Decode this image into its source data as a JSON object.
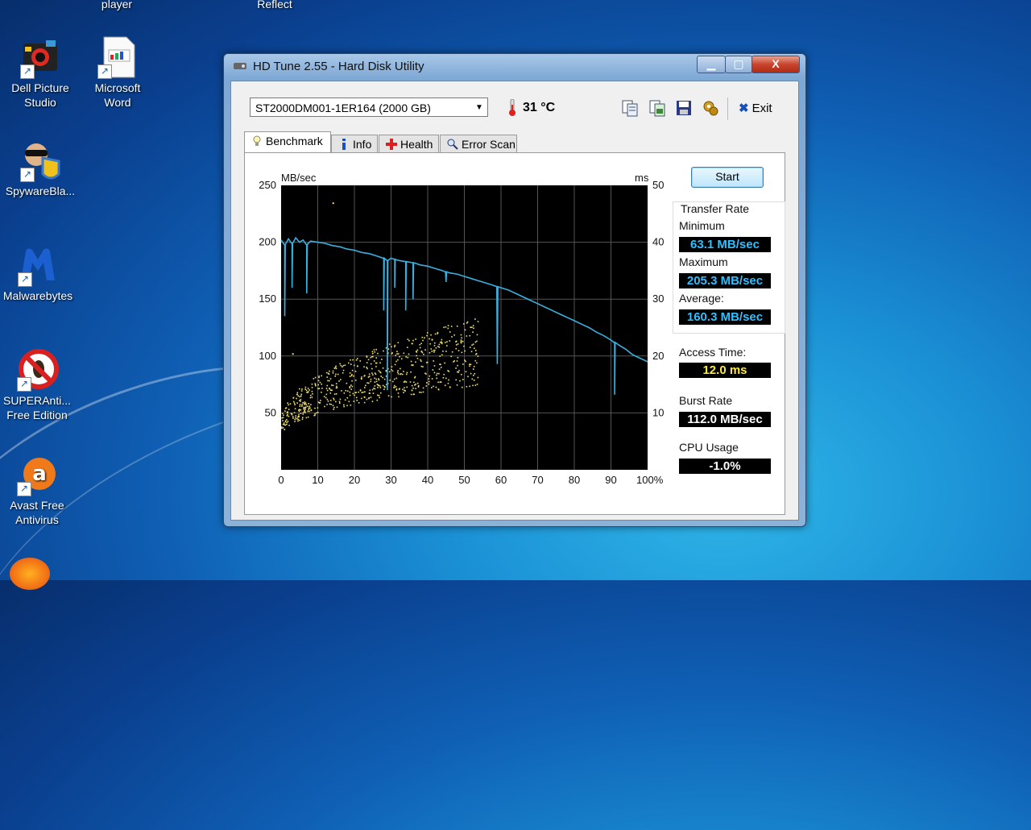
{
  "desktop": {
    "top_labels": [
      "player",
      "Reflect"
    ],
    "icons": [
      {
        "label1": "Dell Picture",
        "label2": "Studio"
      },
      {
        "label1": "Microsoft",
        "label2": "Word"
      },
      {
        "label1": "SpywareBla...",
        "label2": ""
      },
      {
        "label1": "Malwarebytes",
        "label2": ""
      },
      {
        "label1": "SUPERAnti...",
        "label2": "Free Edition"
      },
      {
        "label1": "Avast Free",
        "label2": "Antivirus"
      }
    ]
  },
  "window": {
    "title": "HD Tune 2.55 - Hard Disk Utility",
    "controls": {
      "minimize": "▁",
      "maximize": "▢",
      "close": "X"
    }
  },
  "toolbar": {
    "drive": "ST2000DM001-1ER164 (2000 GB)",
    "temperature": "31 °C",
    "exit_label": "Exit"
  },
  "tabs": [
    "Benchmark",
    "Info",
    "Health",
    "Error Scan"
  ],
  "benchmark": {
    "start_label": "Start",
    "transfer_rate_label": "Transfer Rate",
    "minimum_label": "Minimum",
    "minimum_value": "63.1 MB/sec",
    "maximum_label": "Maximum",
    "maximum_value": "205.3 MB/sec",
    "average_label": "Average:",
    "average_value": "160.3 MB/sec",
    "access_time_label": "Access Time:",
    "access_time_value": "12.0 ms",
    "burst_rate_label": "Burst Rate",
    "burst_rate_value": "112.0 MB/sec",
    "cpu_usage_label": "CPU Usage",
    "cpu_usage_value": "-1.0%"
  },
  "chart_data": {
    "type": "line",
    "ylabel": "MB/sec",
    "y2label": "ms",
    "ylim": [
      0,
      250
    ],
    "y2lim": [
      0,
      50
    ],
    "xlim": [
      0,
      100
    ],
    "yticks": [
      50,
      100,
      150,
      200,
      250
    ],
    "y2ticks": [
      10,
      20,
      30,
      40,
      50
    ],
    "xticks": [
      "0",
      "10",
      "20",
      "30",
      "40",
      "50",
      "60",
      "70",
      "80",
      "90",
      "100%"
    ],
    "grid": true,
    "series": [
      {
        "color": "#3ab0e0",
        "x": [
          0,
          1,
          2,
          3,
          4,
          5,
          6,
          7,
          8,
          10,
          12,
          14,
          16,
          18,
          20,
          22,
          24,
          26,
          28,
          29,
          30,
          31,
          32,
          34,
          36,
          38,
          40,
          42,
          44,
          46,
          48,
          50,
          52,
          54,
          56,
          58,
          60,
          62,
          64,
          66,
          68,
          70,
          72,
          74,
          76,
          78,
          80,
          82,
          84,
          86,
          88,
          90,
          91,
          92,
          94,
          96,
          98,
          100
        ],
        "y": [
          202,
          198,
          203,
          199,
          204,
          200,
          202,
          198,
          201,
          200,
          199,
          197,
          196,
          194,
          193,
          191,
          190,
          188,
          186,
          184,
          186,
          185,
          184,
          183,
          182,
          180,
          179,
          177,
          175,
          173,
          172,
          170,
          168,
          166,
          164,
          162,
          160,
          158,
          155,
          152,
          149,
          146,
          143,
          140,
          137,
          134,
          131,
          128,
          125,
          121,
          118,
          114,
          112,
          110,
          106,
          101,
          98,
          95
        ]
      }
    ],
    "dips": [
      {
        "x": 1,
        "y": 135
      },
      {
        "x": 3,
        "y": 160
      },
      {
        "x": 7,
        "y": 155
      },
      {
        "x": 28,
        "y": 140
      },
      {
        "x": 29,
        "y": 70
      },
      {
        "x": 31,
        "y": 160
      },
      {
        "x": 34,
        "y": 140
      },
      {
        "x": 36,
        "y": 150
      },
      {
        "x": 45,
        "y": 165
      },
      {
        "x": 59,
        "y": 93
      },
      {
        "x": 91,
        "y": 66
      }
    ],
    "access_scatter": {
      "color": "#f0e070",
      "x_range": [
        0,
        54
      ],
      "y_min_ms": [
        6,
        15
      ],
      "y_max_ms": [
        9,
        27
      ]
    }
  }
}
